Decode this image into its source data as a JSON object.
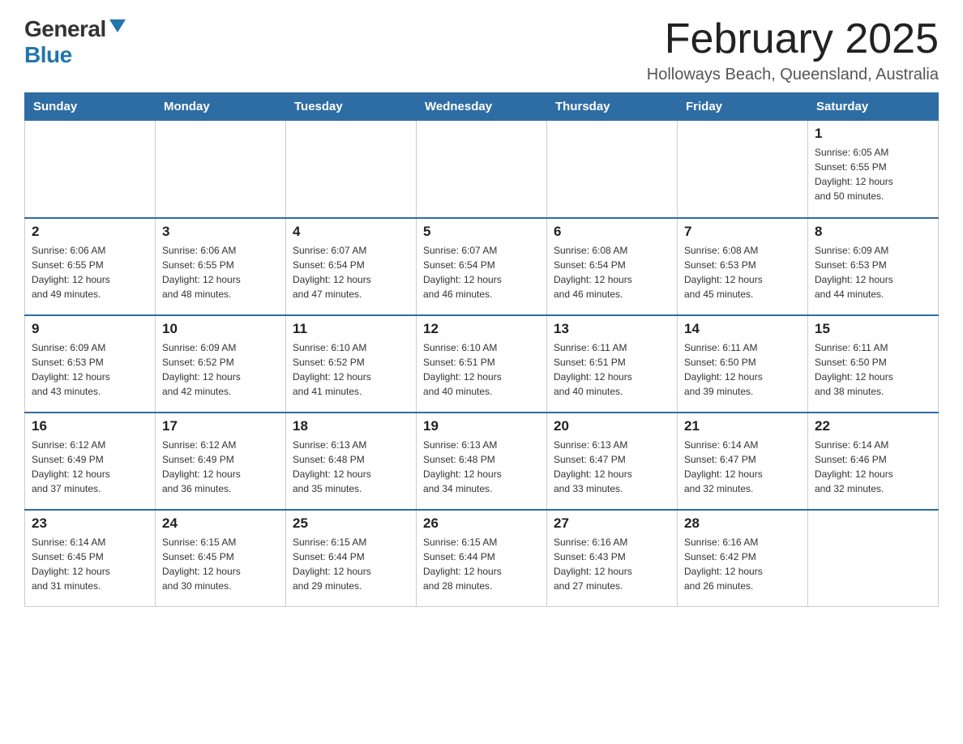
{
  "logo": {
    "general": "General",
    "blue": "Blue"
  },
  "header": {
    "title": "February 2025",
    "location": "Holloways Beach, Queensland, Australia"
  },
  "days_of_week": [
    "Sunday",
    "Monday",
    "Tuesday",
    "Wednesday",
    "Thursday",
    "Friday",
    "Saturday"
  ],
  "weeks": [
    [
      {
        "day": "",
        "info": ""
      },
      {
        "day": "",
        "info": ""
      },
      {
        "day": "",
        "info": ""
      },
      {
        "day": "",
        "info": ""
      },
      {
        "day": "",
        "info": ""
      },
      {
        "day": "",
        "info": ""
      },
      {
        "day": "1",
        "info": "Sunrise: 6:05 AM\nSunset: 6:55 PM\nDaylight: 12 hours\nand 50 minutes."
      }
    ],
    [
      {
        "day": "2",
        "info": "Sunrise: 6:06 AM\nSunset: 6:55 PM\nDaylight: 12 hours\nand 49 minutes."
      },
      {
        "day": "3",
        "info": "Sunrise: 6:06 AM\nSunset: 6:55 PM\nDaylight: 12 hours\nand 48 minutes."
      },
      {
        "day": "4",
        "info": "Sunrise: 6:07 AM\nSunset: 6:54 PM\nDaylight: 12 hours\nand 47 minutes."
      },
      {
        "day": "5",
        "info": "Sunrise: 6:07 AM\nSunset: 6:54 PM\nDaylight: 12 hours\nand 46 minutes."
      },
      {
        "day": "6",
        "info": "Sunrise: 6:08 AM\nSunset: 6:54 PM\nDaylight: 12 hours\nand 46 minutes."
      },
      {
        "day": "7",
        "info": "Sunrise: 6:08 AM\nSunset: 6:53 PM\nDaylight: 12 hours\nand 45 minutes."
      },
      {
        "day": "8",
        "info": "Sunrise: 6:09 AM\nSunset: 6:53 PM\nDaylight: 12 hours\nand 44 minutes."
      }
    ],
    [
      {
        "day": "9",
        "info": "Sunrise: 6:09 AM\nSunset: 6:53 PM\nDaylight: 12 hours\nand 43 minutes."
      },
      {
        "day": "10",
        "info": "Sunrise: 6:09 AM\nSunset: 6:52 PM\nDaylight: 12 hours\nand 42 minutes."
      },
      {
        "day": "11",
        "info": "Sunrise: 6:10 AM\nSunset: 6:52 PM\nDaylight: 12 hours\nand 41 minutes."
      },
      {
        "day": "12",
        "info": "Sunrise: 6:10 AM\nSunset: 6:51 PM\nDaylight: 12 hours\nand 40 minutes."
      },
      {
        "day": "13",
        "info": "Sunrise: 6:11 AM\nSunset: 6:51 PM\nDaylight: 12 hours\nand 40 minutes."
      },
      {
        "day": "14",
        "info": "Sunrise: 6:11 AM\nSunset: 6:50 PM\nDaylight: 12 hours\nand 39 minutes."
      },
      {
        "day": "15",
        "info": "Sunrise: 6:11 AM\nSunset: 6:50 PM\nDaylight: 12 hours\nand 38 minutes."
      }
    ],
    [
      {
        "day": "16",
        "info": "Sunrise: 6:12 AM\nSunset: 6:49 PM\nDaylight: 12 hours\nand 37 minutes."
      },
      {
        "day": "17",
        "info": "Sunrise: 6:12 AM\nSunset: 6:49 PM\nDaylight: 12 hours\nand 36 minutes."
      },
      {
        "day": "18",
        "info": "Sunrise: 6:13 AM\nSunset: 6:48 PM\nDaylight: 12 hours\nand 35 minutes."
      },
      {
        "day": "19",
        "info": "Sunrise: 6:13 AM\nSunset: 6:48 PM\nDaylight: 12 hours\nand 34 minutes."
      },
      {
        "day": "20",
        "info": "Sunrise: 6:13 AM\nSunset: 6:47 PM\nDaylight: 12 hours\nand 33 minutes."
      },
      {
        "day": "21",
        "info": "Sunrise: 6:14 AM\nSunset: 6:47 PM\nDaylight: 12 hours\nand 32 minutes."
      },
      {
        "day": "22",
        "info": "Sunrise: 6:14 AM\nSunset: 6:46 PM\nDaylight: 12 hours\nand 32 minutes."
      }
    ],
    [
      {
        "day": "23",
        "info": "Sunrise: 6:14 AM\nSunset: 6:45 PM\nDaylight: 12 hours\nand 31 minutes."
      },
      {
        "day": "24",
        "info": "Sunrise: 6:15 AM\nSunset: 6:45 PM\nDaylight: 12 hours\nand 30 minutes."
      },
      {
        "day": "25",
        "info": "Sunrise: 6:15 AM\nSunset: 6:44 PM\nDaylight: 12 hours\nand 29 minutes."
      },
      {
        "day": "26",
        "info": "Sunrise: 6:15 AM\nSunset: 6:44 PM\nDaylight: 12 hours\nand 28 minutes."
      },
      {
        "day": "27",
        "info": "Sunrise: 6:16 AM\nSunset: 6:43 PM\nDaylight: 12 hours\nand 27 minutes."
      },
      {
        "day": "28",
        "info": "Sunrise: 6:16 AM\nSunset: 6:42 PM\nDaylight: 12 hours\nand 26 minutes."
      },
      {
        "day": "",
        "info": ""
      }
    ]
  ]
}
